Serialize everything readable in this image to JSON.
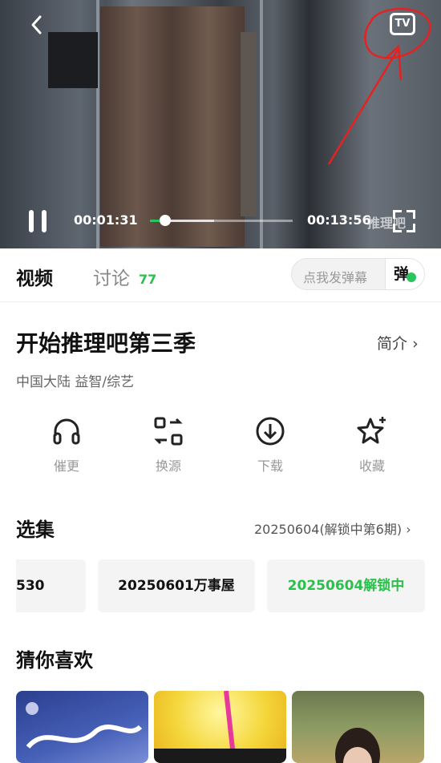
{
  "player": {
    "time_current": "00:01:31",
    "time_total": "00:13:56",
    "progress": 0.109,
    "buffered": 0.45,
    "watermark": "推理吧",
    "tv_label": "TV"
  },
  "tabs": {
    "video": "视频",
    "discussion": "讨论",
    "discussion_count": "77"
  },
  "danmu": {
    "placeholder": "点我发弹幕",
    "button": "弹"
  },
  "show": {
    "title": "开始推理吧第三季",
    "intro_label": "简介",
    "meta": "中国大陆  益智/综艺"
  },
  "actions": [
    {
      "label": "催更",
      "icon": "headphones-icon"
    },
    {
      "label": "换源",
      "icon": "switch-source-icon"
    },
    {
      "label": "下载",
      "icon": "download-icon"
    },
    {
      "label": "收藏",
      "icon": "star-icon"
    }
  ],
  "episodes": {
    "title": "选集",
    "info": "20250604(解锁中第6期)",
    "items": [
      "530",
      "20250601万事屋",
      "20250604解锁中"
    ],
    "active_color": "#2bbf4c"
  },
  "recommend": {
    "title": "猜你喜欢"
  }
}
